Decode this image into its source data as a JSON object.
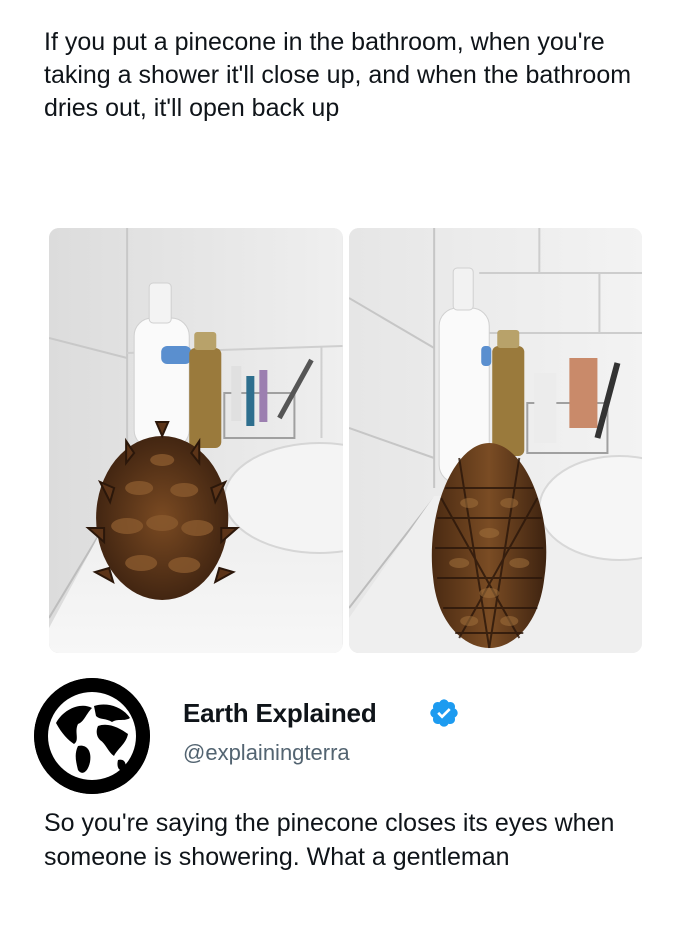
{
  "post": {
    "text": "If you put a pinecone in the bathroom, when you're taking a shower it'll close up, and when the bathroom dries out, it'll open back up"
  },
  "images": [
    {
      "subject": "open-pinecone-photo"
    },
    {
      "subject": "closed-pinecone-photo"
    }
  ],
  "reply": {
    "display_name": "Earth Explained",
    "handle": "@explainingterra",
    "text": "So you're saying the pinecone closes its eyes when someone is showering. What a gentleman",
    "verified_color": "#1d9bf0"
  }
}
